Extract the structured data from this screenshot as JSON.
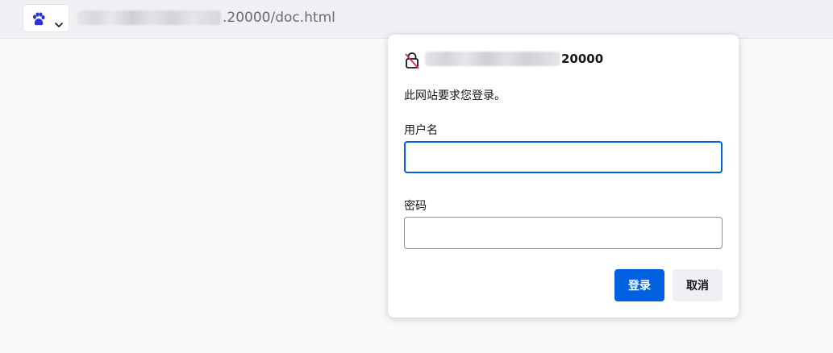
{
  "url_bar": {
    "url_visible_text": ".20000/doc.html",
    "search_engine_icon": "baidu-paw-icon",
    "dropdown_icon": "chevron-down-icon"
  },
  "auth_dialog": {
    "lock_icon": "insecure-lock-icon",
    "host_visible_text": "20000",
    "message": "此网站要求您登录。",
    "username_label": "用户名",
    "username_value": "",
    "password_label": "密码",
    "password_value": "",
    "login_button": "登录",
    "cancel_button": "取消"
  },
  "colors": {
    "accent": "#0061e0",
    "page_bg": "#f9f9fb",
    "toolbar_bg": "#f0f0f4",
    "text": "#15141a",
    "url_text": "#6b6b74",
    "engine_icon": "#2932e1"
  }
}
